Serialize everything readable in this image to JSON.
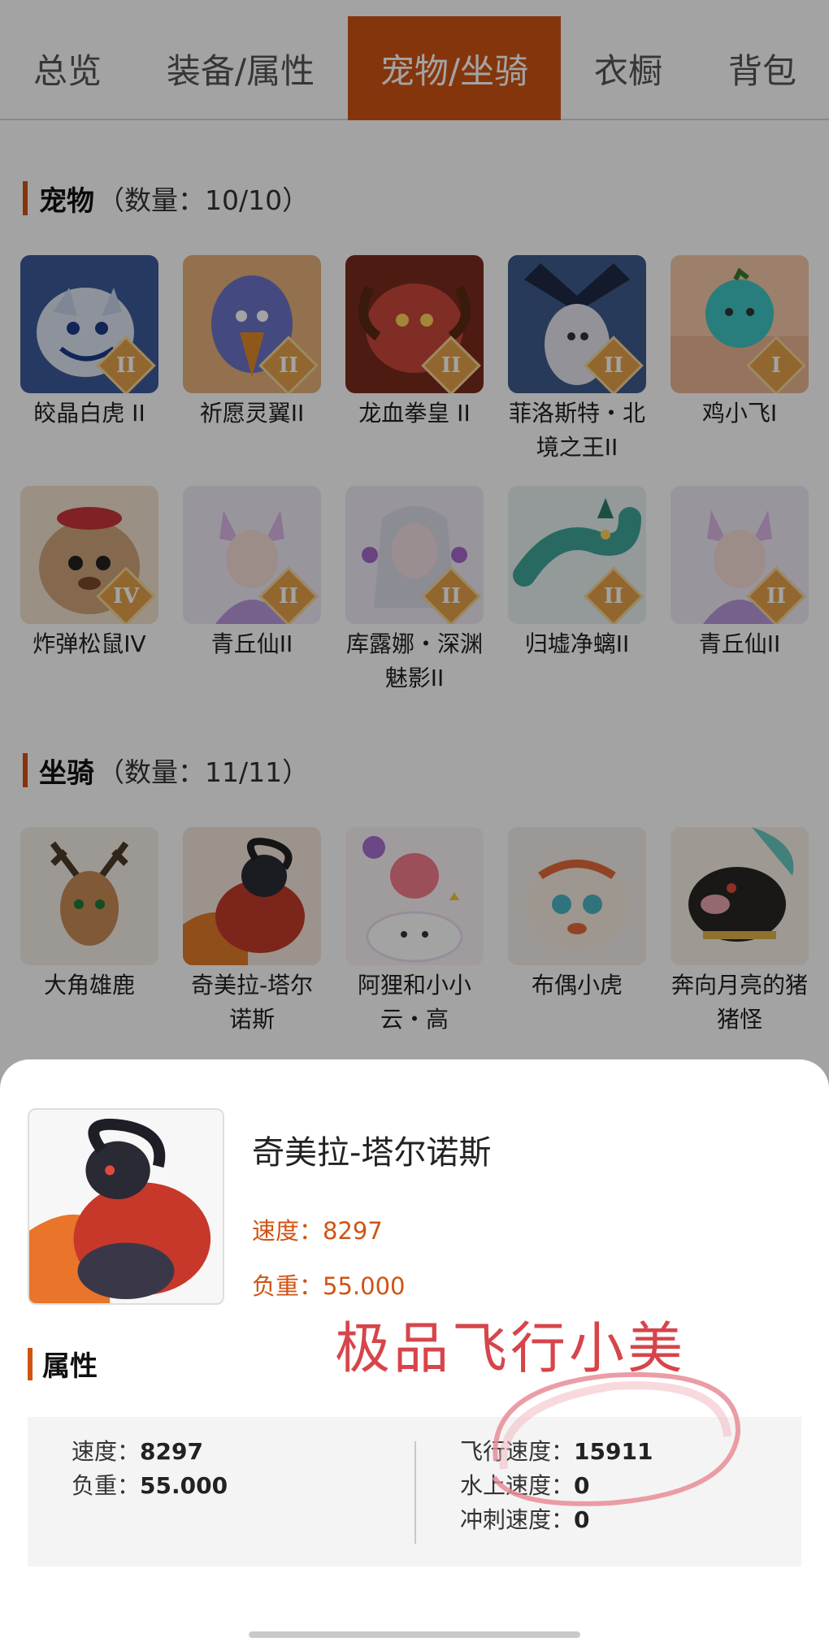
{
  "tabs": [
    {
      "label": "总览",
      "active": false
    },
    {
      "label": "装备/属性",
      "active": false
    },
    {
      "label": "宠物/坐骑",
      "active": true
    },
    {
      "label": "衣橱",
      "active": false
    },
    {
      "label": "背包",
      "active": false
    }
  ],
  "pets_section": {
    "title": "宠物",
    "count": "（数量：10/10）"
  },
  "pets": [
    {
      "name": "皎晶白虎 II",
      "rank": "II"
    },
    {
      "name": "祈愿灵翼II",
      "rank": "II"
    },
    {
      "name": "龙血拳皇 II",
      "rank": "II"
    },
    {
      "name": "菲洛斯特・北境之王II",
      "rank": "II"
    },
    {
      "name": "鸡小飞I",
      "rank": "I"
    },
    {
      "name": "炸弹松鼠IV",
      "rank": "IV"
    },
    {
      "name": "青丘仙II",
      "rank": "II"
    },
    {
      "name": "库露娜・深渊魅影II",
      "rank": "II"
    },
    {
      "name": "归墟净螭II",
      "rank": "II"
    },
    {
      "name": "青丘仙II",
      "rank": "II"
    }
  ],
  "mounts_section": {
    "title": "坐骑",
    "count": "（数量：11/11）"
  },
  "mounts": [
    {
      "name": "大角雄鹿"
    },
    {
      "name": "奇美拉-塔尔诺斯"
    },
    {
      "name": "阿狸和小小云・高"
    },
    {
      "name": "布偶小虎"
    },
    {
      "name": "奔向月亮的猪猪怪"
    }
  ],
  "detail": {
    "name": "奇美拉-塔尔诺斯",
    "speed": "速度：8297",
    "load": "负重：55.000",
    "attr_title": "属性",
    "attrs_left": [
      {
        "label": "速度：",
        "value": "8297"
      },
      {
        "label": "负重：",
        "value": "55.000"
      }
    ],
    "attrs_right": [
      {
        "label": "飞行速度：",
        "value": "15911"
      },
      {
        "label": "水上速度：",
        "value": "0"
      },
      {
        "label": "冲刺速度：",
        "value": "0"
      }
    ]
  },
  "annotation": "极品飞行小美",
  "colors": {
    "accent": "#d05312",
    "annotation": "#d6454b"
  }
}
